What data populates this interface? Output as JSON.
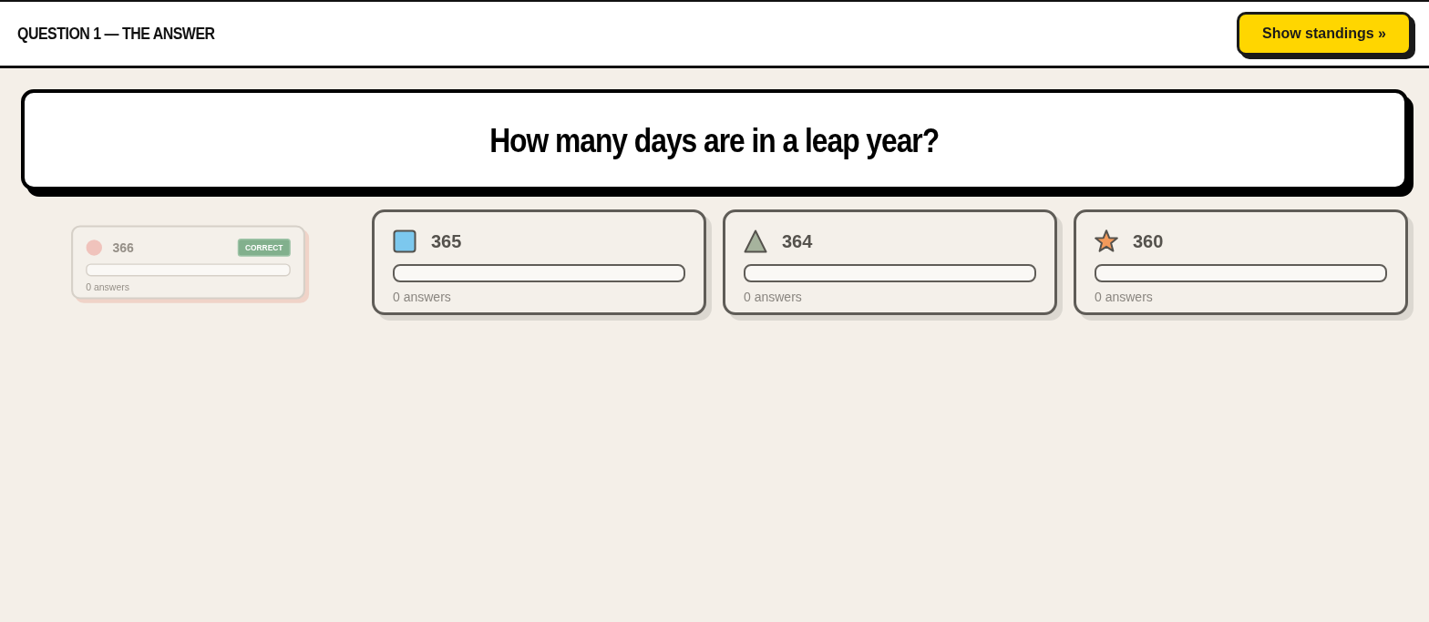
{
  "header": {
    "title": "QUESTION 1 — THE ANSWER",
    "button": "Show standings »"
  },
  "question": "How many days are in a leap year?",
  "options": [
    {
      "kind": "circle",
      "color": "#f0c3bc",
      "label": "366",
      "correct": true,
      "badge": "CORRECT",
      "dimmed": true,
      "level": 0,
      "count": "0 answers"
    },
    {
      "kind": "square",
      "color": "#7cc8ee",
      "label": "365",
      "correct": false,
      "dimmed": false,
      "level": 0,
      "count": "0 answers"
    },
    {
      "kind": "triangle",
      "color": "#a6b39d",
      "label": "364",
      "correct": false,
      "dimmed": false,
      "level": 0,
      "count": "0 answers"
    },
    {
      "kind": "star",
      "color": "#f39a5b",
      "label": "360",
      "correct": false,
      "dimmed": false,
      "level": 0,
      "count": "0 answers"
    }
  ]
}
